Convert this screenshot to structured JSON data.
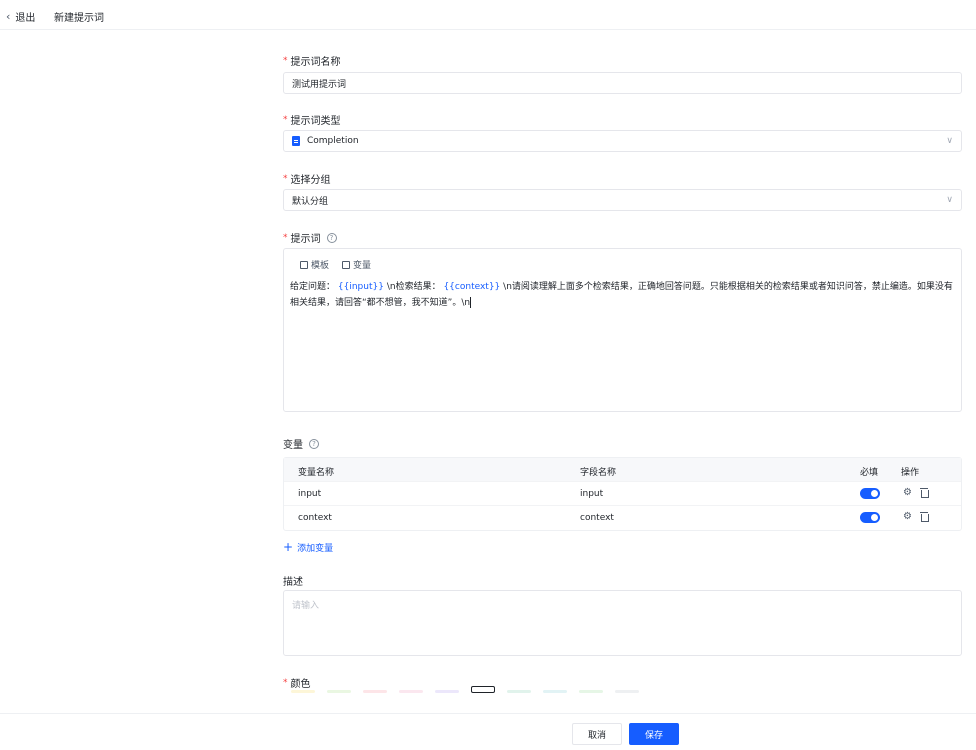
{
  "header": {
    "back_label": "退出",
    "page_title": "新建提示词"
  },
  "form": {
    "name": {
      "label": "提示词名称",
      "value": "测试用提示词"
    },
    "type": {
      "label": "提示词类型",
      "value": "Completion"
    },
    "group": {
      "label": "选择分组",
      "value": "默认分组"
    },
    "prompt": {
      "label": "提示词",
      "tools": {
        "template": "模板",
        "variable": "变量"
      },
      "seg1": "给定问题：",
      "var1": "{{input}}",
      "seg2": "\\n检索结果：",
      "var2": "{{context}}",
      "seg3": "\\n请阅读理解上面多个检索结果，正确地回答问题。只能根据相关的检索结果或者知识问答，禁止编造。如果没有相关结果，请回答“都不想管，我不知道”。\\n"
    },
    "variables": {
      "label": "变量",
      "columns": {
        "name": "变量名称",
        "field": "字段名称",
        "required": "必填",
        "actions": "操作"
      },
      "rows": [
        {
          "name": "input",
          "field": "input",
          "required": true
        },
        {
          "name": "context",
          "field": "context",
          "required": true
        }
      ],
      "add_label": "添加变量"
    },
    "description": {
      "label": "描述",
      "placeholder": "请输入"
    },
    "color": {
      "label": "颜色",
      "swatches": [
        "#fdf6d8",
        "#eaf7e2",
        "#fde5e8",
        "#fbe7ef",
        "#ece7fb",
        "#ffffff",
        "#e1f3ec",
        "#e2f3f5",
        "#e6f6e6",
        "#eef0f2"
      ]
    }
  },
  "footer": {
    "cancel_label": "取消",
    "save_label": "保存"
  },
  "colors": {
    "primary": "#165dff",
    "required": "#f53f3f"
  }
}
